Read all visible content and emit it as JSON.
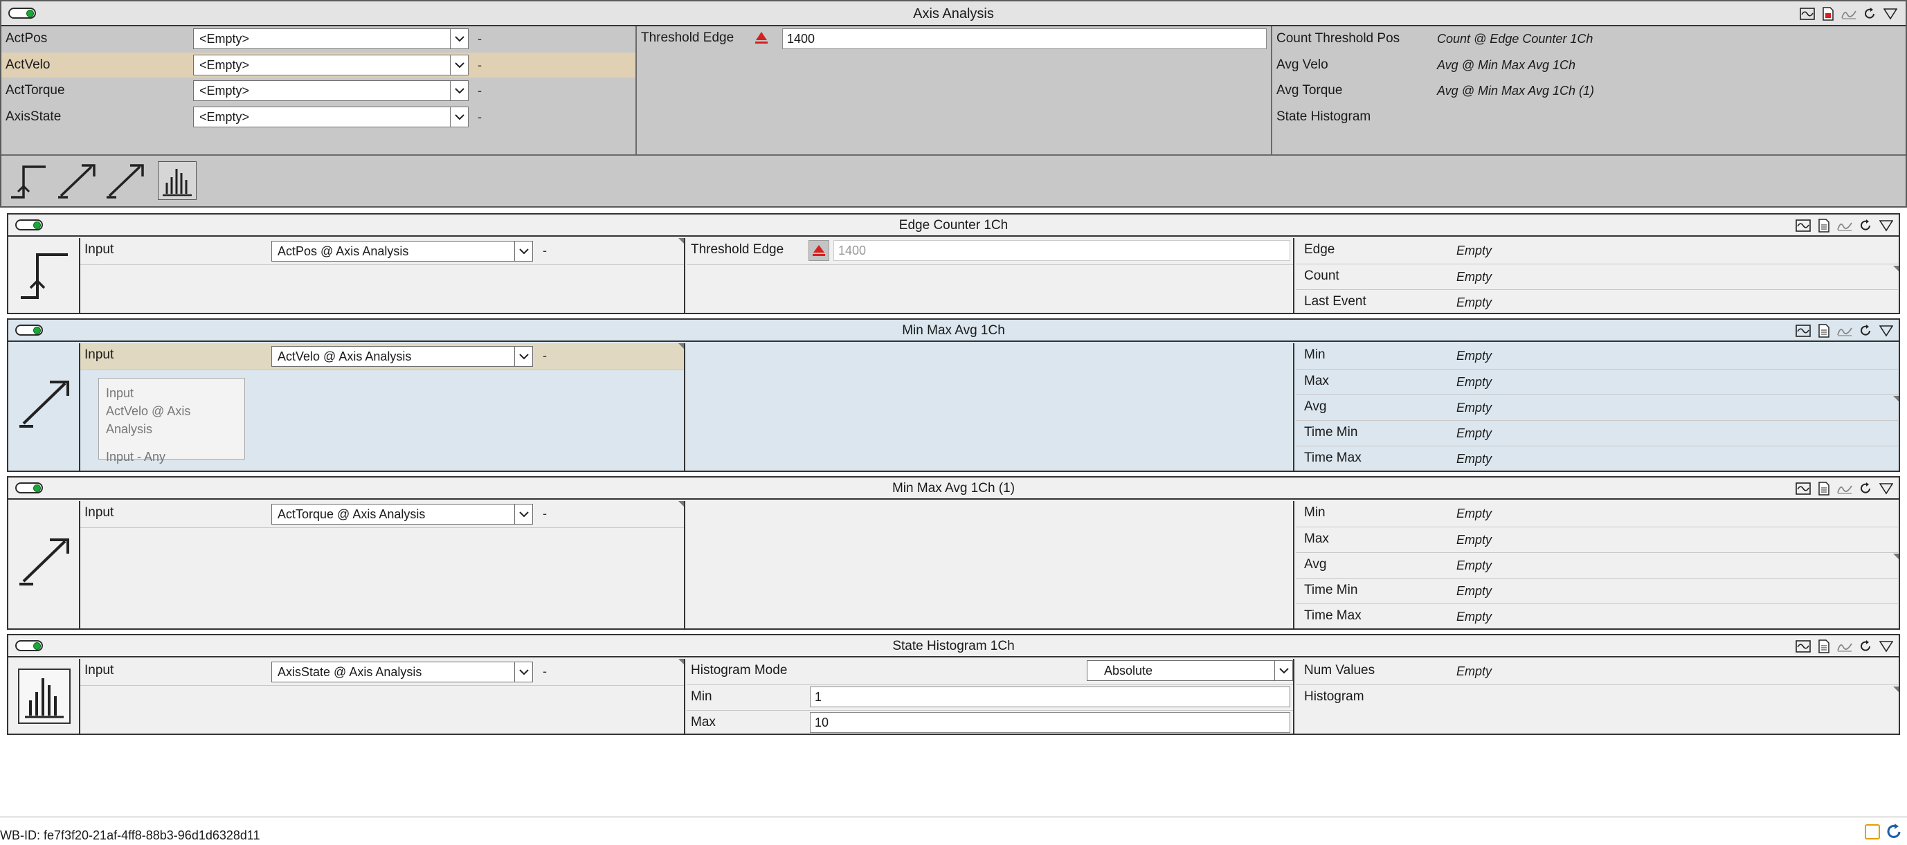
{
  "top": {
    "title": "Axis Analysis",
    "inputs": [
      {
        "label": "ActPos",
        "value": "<Empty>",
        "dash": "-"
      },
      {
        "label": "ActVelo",
        "value": "<Empty>",
        "dash": "-"
      },
      {
        "label": "ActTorque",
        "value": "<Empty>",
        "dash": "-"
      },
      {
        "label": "AxisState",
        "value": "<Empty>",
        "dash": "-"
      }
    ],
    "threshold_label": "Threshold Edge",
    "threshold_value": "1400",
    "outputs": [
      {
        "label": "Count Threshold Pos",
        "value": "Count @ Edge Counter 1Ch"
      },
      {
        "label": "Avg Velo",
        "value": "Avg @ Min Max Avg 1Ch"
      },
      {
        "label": "Avg Torque",
        "value": "Avg @ Min Max Avg 1Ch (1)"
      },
      {
        "label": "State Histogram",
        "value": ""
      }
    ]
  },
  "blocks": {
    "edge": {
      "title": "Edge Counter 1Ch",
      "input_label": "Input",
      "input_value": "ActPos @ Axis Analysis",
      "dash": "-",
      "param_label": "Threshold Edge",
      "param_value": "1400",
      "outputs": [
        {
          "label": "Edge",
          "value": "Empty"
        },
        {
          "label": "Count",
          "value": "Empty"
        },
        {
          "label": "Last Event",
          "value": "Empty"
        }
      ]
    },
    "minmax": {
      "title": "Min Max Avg 1Ch",
      "input_label": "Input",
      "input_value": "ActVelo @ Axis Analysis",
      "dash": "-",
      "tooltip": {
        "line1": "Input",
        "line2": "ActVelo @ Axis Analysis",
        "line3": "Input - Any"
      },
      "outputs": [
        {
          "label": "Min",
          "value": "Empty"
        },
        {
          "label": "Max",
          "value": "Empty"
        },
        {
          "label": "Avg",
          "value": "Empty"
        },
        {
          "label": "Time Min",
          "value": "Empty"
        },
        {
          "label": "Time Max",
          "value": "Empty"
        }
      ]
    },
    "minmax1": {
      "title": "Min Max Avg 1Ch (1)",
      "input_label": "Input",
      "input_value": "ActTorque @ Axis Analysis",
      "dash": "-",
      "outputs": [
        {
          "label": "Min",
          "value": "Empty"
        },
        {
          "label": "Max",
          "value": "Empty"
        },
        {
          "label": "Avg",
          "value": "Empty"
        },
        {
          "label": "Time Min",
          "value": "Empty"
        },
        {
          "label": "Time Max",
          "value": "Empty"
        }
      ]
    },
    "hist": {
      "title": "State Histogram 1Ch",
      "input_label": "Input",
      "input_value": "AxisState @ Axis Analysis",
      "dash": "-",
      "mode_label": "Histogram Mode",
      "mode_value": "Absolute",
      "min_label": "Min",
      "min_value": "1",
      "max_label": "Max",
      "max_value": "10",
      "outputs": [
        {
          "label": "Num Values",
          "value": "Empty"
        },
        {
          "label": "Histogram",
          "value": ""
        }
      ]
    }
  },
  "footer": {
    "wbid": "WB-ID: fe7f3f20-21af-4ff8-88b3-96d1d6328d11"
  },
  "colors": {
    "toggle_on": "#1aa83a",
    "highlight_row": "#e0d0b4",
    "active_block": "#dbe6ee",
    "threshold_icon": "#d62020"
  },
  "icons": [
    "graph-icon",
    "doc-icon",
    "signal-icon",
    "refresh-icon",
    "filter-icon",
    "edge-counter-icon",
    "min-max-icon",
    "histogram-icon"
  ]
}
